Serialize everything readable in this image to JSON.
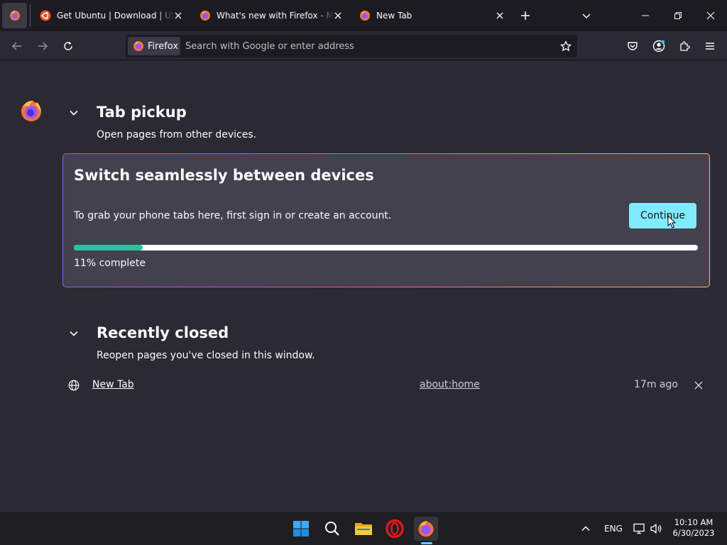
{
  "tabs": [
    {
      "title": "Get Ubuntu | Download | Ubuntu",
      "icon": "ubuntu-icon"
    },
    {
      "title": "What's new with Firefox - More",
      "icon": "firefox-icon"
    },
    {
      "title": "New Tab",
      "icon": "firefox-icon",
      "active": true
    }
  ],
  "urlbar": {
    "identity_label": "Firefox",
    "placeholder": "Search with Google or enter address"
  },
  "tab_pickup": {
    "title": "Tab pickup",
    "subtitle": "Open pages from other devices.",
    "card": {
      "title": "Switch seamlessly between devices",
      "text": "To grab your phone tabs here, first sign in or create an account.",
      "button_label": "Continue",
      "progress_percent": 11,
      "progress_label": "11% complete"
    }
  },
  "recently_closed": {
    "title": "Recently closed",
    "subtitle": "Reopen pages you've closed in this window.",
    "items": [
      {
        "title": "New Tab",
        "url": "about:home",
        "time": "17m ago"
      }
    ]
  },
  "taskbar": {
    "language": "ENG",
    "time": "10:10 AM",
    "date": "6/30/2023"
  },
  "colors": {
    "accent": "#80ebff",
    "progress": "#2ac3a2",
    "background": "#2b2a33"
  }
}
